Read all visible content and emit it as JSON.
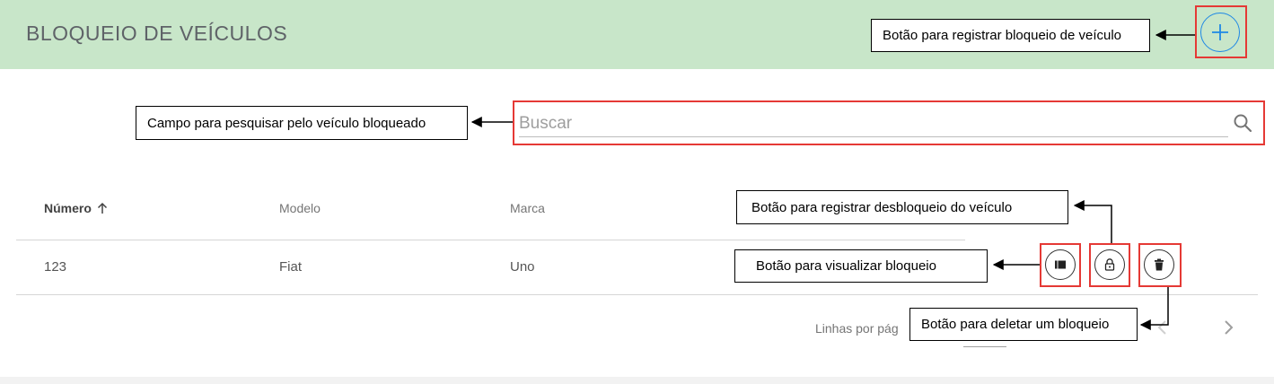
{
  "header": {
    "title": "BLOQUEIO DE VEÍCULOS",
    "add_button_icon": "plus-icon"
  },
  "search": {
    "placeholder": "Buscar",
    "value": "",
    "icon": "search-icon"
  },
  "table": {
    "columns": [
      {
        "label": "Número",
        "sort": "ascending"
      },
      {
        "label": "Modelo"
      },
      {
        "label": "Marca"
      }
    ],
    "rows": [
      {
        "numero": "123",
        "modelo": "Fiat",
        "marca": "Uno"
      }
    ],
    "row_actions": [
      {
        "icon": "view-icon"
      },
      {
        "icon": "unlock-icon"
      },
      {
        "icon": "trash-icon"
      }
    ]
  },
  "pagination": {
    "rows_per_page_label": "Linhas por pág"
  },
  "annotations": {
    "add_block": "Botão para registrar bloqueio de veículo",
    "search_field": "Campo para pesquisar pelo veículo bloqueado",
    "unlock": "Botão para registrar desbloqueio do veículo",
    "view": "Botão para visualizar bloqueio",
    "delete": "Botão para deletar um bloqueio"
  },
  "colors": {
    "header_bg": "#c8e6c9",
    "accent_blue": "#1e88e5",
    "highlight_red": "#e53935"
  }
}
